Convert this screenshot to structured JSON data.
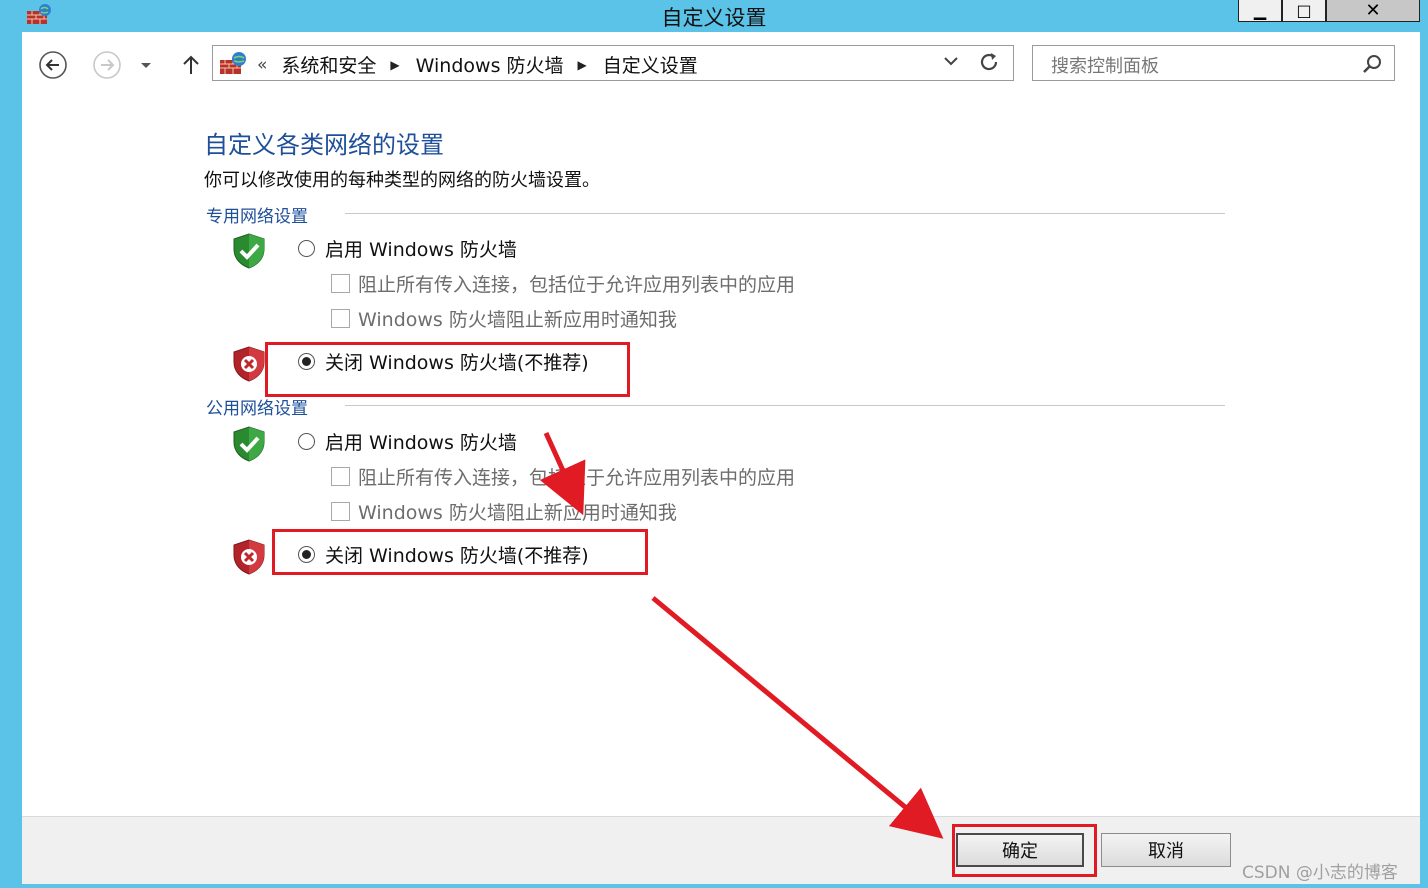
{
  "window": {
    "title": "自定义设置",
    "minimize_glyph": "▁",
    "maximize_glyph": "□",
    "close_glyph": "✕"
  },
  "nav": {
    "back_icon": "back-arrow-icon",
    "forward_icon": "forward-arrow-icon",
    "recent_icon": "chevron-down-icon",
    "up_icon": "up-arrow-icon"
  },
  "address": {
    "overflow": "«",
    "crumbs": [
      "系统和安全",
      "Windows 防火墙",
      "自定义设置"
    ],
    "separator": "▶"
  },
  "search": {
    "placeholder": "搜索控制面板"
  },
  "page": {
    "title": "自定义各类网络的设置",
    "description": "你可以修改使用的每种类型的网络的防火墙设置。"
  },
  "private_network": {
    "header": "专用网络设置",
    "enable_label": "启用 Windows 防火墙",
    "block_all_label": "阻止所有传入连接，包括位于允许应用列表中的应用",
    "notify_label": "Windows 防火墙阻止新应用时通知我",
    "disable_label": "关闭 Windows 防火墙(不推荐)",
    "selected": "disable"
  },
  "public_network": {
    "header": "公用网络设置",
    "enable_label": "启用 Windows 防火墙",
    "block_all_label": "阻止所有传入连接，包括位于允许应用列表中的应用",
    "notify_label": "Windows 防火墙阻止新应用时通知我",
    "disable_label": "关闭 Windows 防火墙(不推荐)",
    "selected": "disable"
  },
  "buttons": {
    "ok": "确定",
    "cancel": "取消"
  },
  "watermark": "CSDN @小志的博客",
  "colors": {
    "annotation_red": "#e01b24",
    "title_blue": "#1e4f98",
    "frame_blue": "#5bc3e8"
  }
}
